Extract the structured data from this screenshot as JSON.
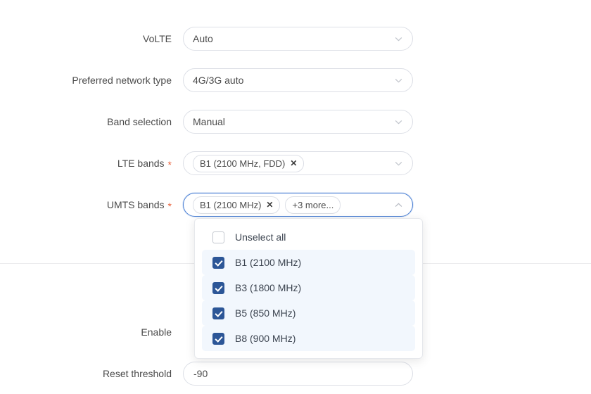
{
  "form": {
    "rows": [
      {
        "label": "VoLTE",
        "required": false,
        "type": "select",
        "value": "Auto",
        "icon": "chevron-down-icon",
        "name": "volte"
      },
      {
        "label": "Preferred network type",
        "required": false,
        "type": "select",
        "value": "4G/3G auto",
        "icon": "chevron-down-icon",
        "name": "preferred-network-type"
      },
      {
        "label": "Band selection",
        "required": false,
        "type": "select",
        "value": "Manual",
        "icon": "chevron-down-icon",
        "name": "band-selection"
      },
      {
        "label": "LTE bands",
        "required": true,
        "type": "multiselect",
        "icon": "chevron-down-icon",
        "name": "lte-bands",
        "chips": [
          {
            "text": "B1 (2100 MHz, FDD)",
            "removable": true,
            "remove_glyph": "✕"
          }
        ]
      },
      {
        "label": "UMTS bands",
        "required": true,
        "type": "multiselect",
        "icon": "chevron-up-icon",
        "name": "umts-bands",
        "focused": true,
        "chips": [
          {
            "text": "B1 (2100 MHz)",
            "removable": true,
            "remove_glyph": "✕"
          },
          {
            "text": "+3 more...",
            "removable": false,
            "remove_glyph": ""
          }
        ]
      },
      {
        "label": "Enable",
        "required": false,
        "type": "hidden-control",
        "name": "enable"
      },
      {
        "label": "Reset threshold",
        "required": false,
        "type": "text",
        "value": "-90",
        "placeholder": "",
        "name": "reset-threshold"
      }
    ],
    "required_marker": "*"
  },
  "dropdown": {
    "owner": "umts-bands",
    "options": [
      {
        "label": "Unselect all",
        "checked": false,
        "selected": false
      },
      {
        "label": "B1 (2100 MHz)",
        "checked": true,
        "selected": true
      },
      {
        "label": "B3 (1800 MHz)",
        "checked": true,
        "selected": true
      },
      {
        "label": "B5 (850 MHz)",
        "checked": true,
        "selected": true
      },
      {
        "label": "B8 (900 MHz)",
        "checked": true,
        "selected": true
      }
    ]
  },
  "colors": {
    "accent_blue": "#2c5697",
    "focus_blue": "#4a7fd4",
    "required_red": "#e8613c",
    "selected_row_bg": "#f2f7fd",
    "border_gray": "#dcdfe6",
    "divider_gray": "#ececee",
    "text_primary": "#4a4a4a"
  }
}
